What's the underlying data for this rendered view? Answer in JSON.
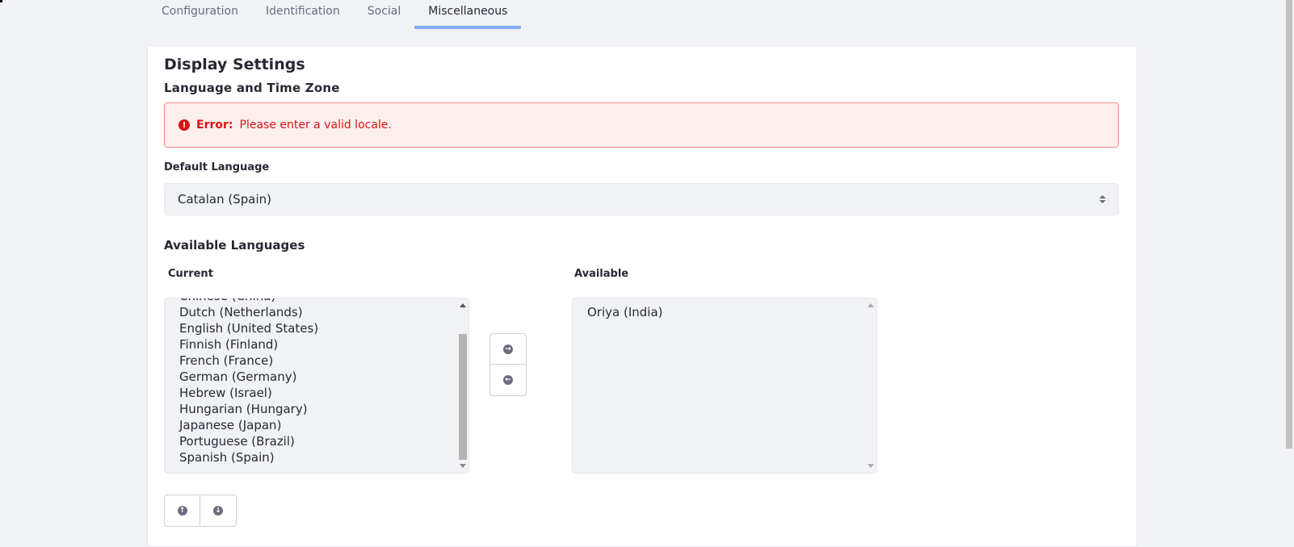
{
  "tabs": [
    {
      "label": "Configuration"
    },
    {
      "label": "Identification"
    },
    {
      "label": "Social"
    },
    {
      "label": "Miscellaneous"
    }
  ],
  "card": {
    "title": "Display Settings",
    "section_title": "Language and Time Zone",
    "alert": {
      "lead": "Error:",
      "message": "Please enter a valid locale.",
      "icon": "exclamation-circle-icon"
    },
    "default_language": {
      "label": "Default Language",
      "value": "Catalan (Spain)"
    },
    "available_languages": {
      "title": "Available Languages",
      "current_label": "Current",
      "available_label": "Available",
      "current_items": [
        "Chinese (China)",
        "Dutch (Netherlands)",
        "English (United States)",
        "Finnish (Finland)",
        "French (France)",
        "German (Germany)",
        "Hebrew (Israel)",
        "Hungarian (Hungary)",
        "Japanese (Japan)",
        "Portuguese (Brazil)",
        "Spanish (Spain)"
      ],
      "available_items": [
        "Oriya (India)"
      ]
    }
  },
  "colors": {
    "accent": "#80acff",
    "error": "#da1414",
    "error_bg": "#feefef",
    "page_bg": "#f1f2f5"
  }
}
